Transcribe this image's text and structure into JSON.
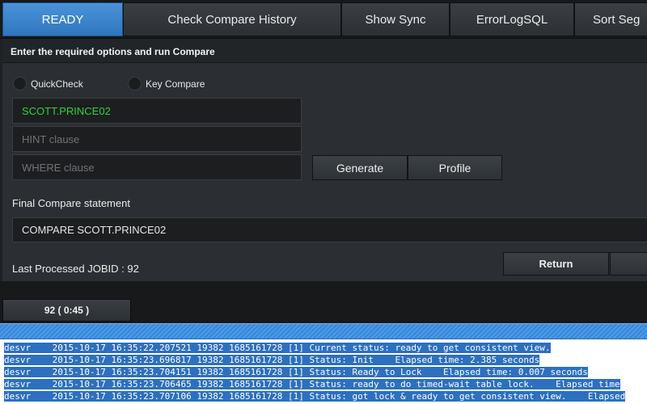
{
  "tabs": [
    {
      "label": "READY",
      "active": true
    },
    {
      "label": "Check Compare History"
    },
    {
      "label": "Show Sync"
    },
    {
      "label": "ErrorLogSQL"
    },
    {
      "label": "Sort Seg"
    }
  ],
  "panel": {
    "header": "Enter the required options and run Compare",
    "options": {
      "quickcheck": "QuickCheck",
      "keycompare": "Key Compare"
    },
    "table_field": "SCOTT.PRINCE02",
    "hint_placeholder": "HINT clause",
    "where_placeholder": "WHERE clause",
    "generate_label": "Generate",
    "profile_label": "Profile",
    "final_label": "Final Compare statement",
    "final_statement": "COMPARE SCOTT.PRINCE02",
    "last_job": "Last Processed JOBID : 92",
    "return_label": "Return"
  },
  "job_tab": "92 ( 0:45 )",
  "colors": {
    "accent": "#3b86d3",
    "status_green": "#2fd33a",
    "log_highlight": "#2d6fc0"
  },
  "log": [
    "desvr    2015-10-17 16:35:22.207521 19382 1685161728 [1] Current status: ready to get consistent view.",
    "desvr    2015-10-17 16:35:23.696817 19382 1685161728 [1] Status: Init    Elapsed time: 2.385 seconds",
    "desvr    2015-10-17 16:35:23.704151 19382 1685161728 [1] Status: Ready to Lock    Elapsed time: 0.007 seconds",
    "desvr    2015-10-17 16:35:23.706465 19382 1685161728 [1] Status: ready to do timed-wait table lock.    Elapsed time",
    "desvr    2015-10-17 16:35:23.707106 19382 1685161728 [1] Status: got lock & ready to get consistent view.    Elapsed"
  ]
}
